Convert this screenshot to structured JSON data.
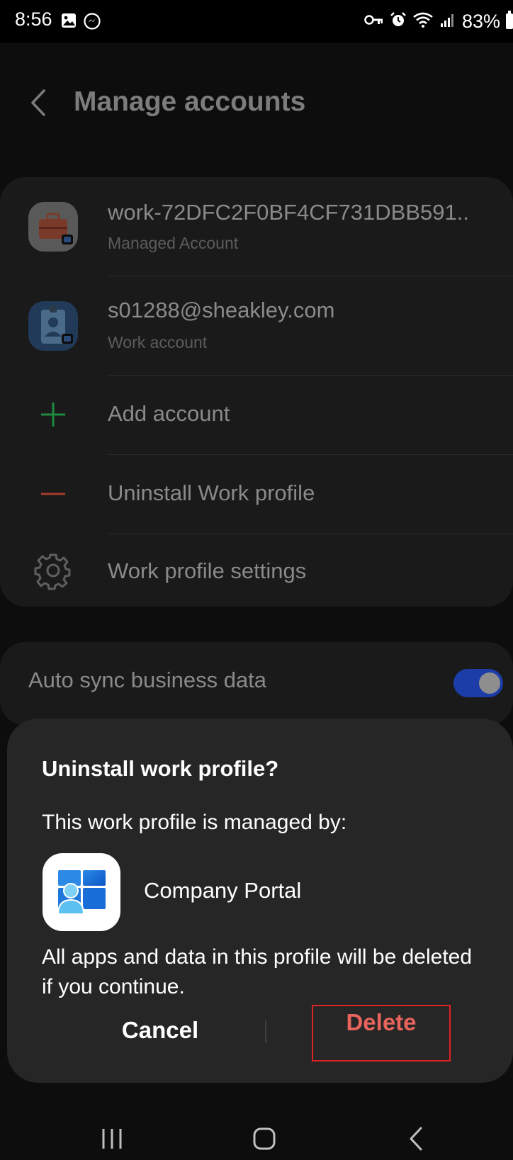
{
  "status_bar": {
    "time": "8:56",
    "left_icons": [
      "image-icon",
      "messenger-icon"
    ],
    "right_icons": [
      "vpn-key-icon",
      "alarm-icon",
      "wifi-icon",
      "signal-icon",
      "battery-icon"
    ],
    "battery_percent": "83%"
  },
  "header": {
    "back_icon": "chevron-left-icon",
    "title": "Manage accounts"
  },
  "accounts": {
    "items": [
      {
        "title": "work-72DFC2F0BF4CF731DBB591..",
        "subtitle": "Managed Account",
        "icon": "briefcase-icon"
      },
      {
        "title": "s01288@sheakley.com",
        "subtitle": "Work account",
        "icon": "id-badge-icon"
      },
      {
        "title": "Add account",
        "icon": "plus-icon"
      },
      {
        "title": "Uninstall Work profile",
        "icon": "minus-icon"
      },
      {
        "title": "Work profile settings",
        "icon": "gear-icon"
      }
    ]
  },
  "sync": {
    "label": "Auto sync business data",
    "enabled": true
  },
  "dialog": {
    "title": "Uninstall work profile?",
    "managed_by_text": "This work profile is managed by:",
    "app_name": "Company Portal",
    "app_icon": "company-portal-icon",
    "warning": "All apps and data in this profile will be deleted if you continue.",
    "cancel_label": "Cancel",
    "delete_label": "Delete"
  },
  "nav_bar": {
    "icons": [
      "recents-icon",
      "home-icon",
      "back-icon"
    ]
  },
  "colors": {
    "accent_toggle": "#1c3da8",
    "delete_text": "#e8645c",
    "highlight_box": "#e02222",
    "add_icon": "#1d8a3f",
    "remove_icon": "#a83a2c"
  }
}
